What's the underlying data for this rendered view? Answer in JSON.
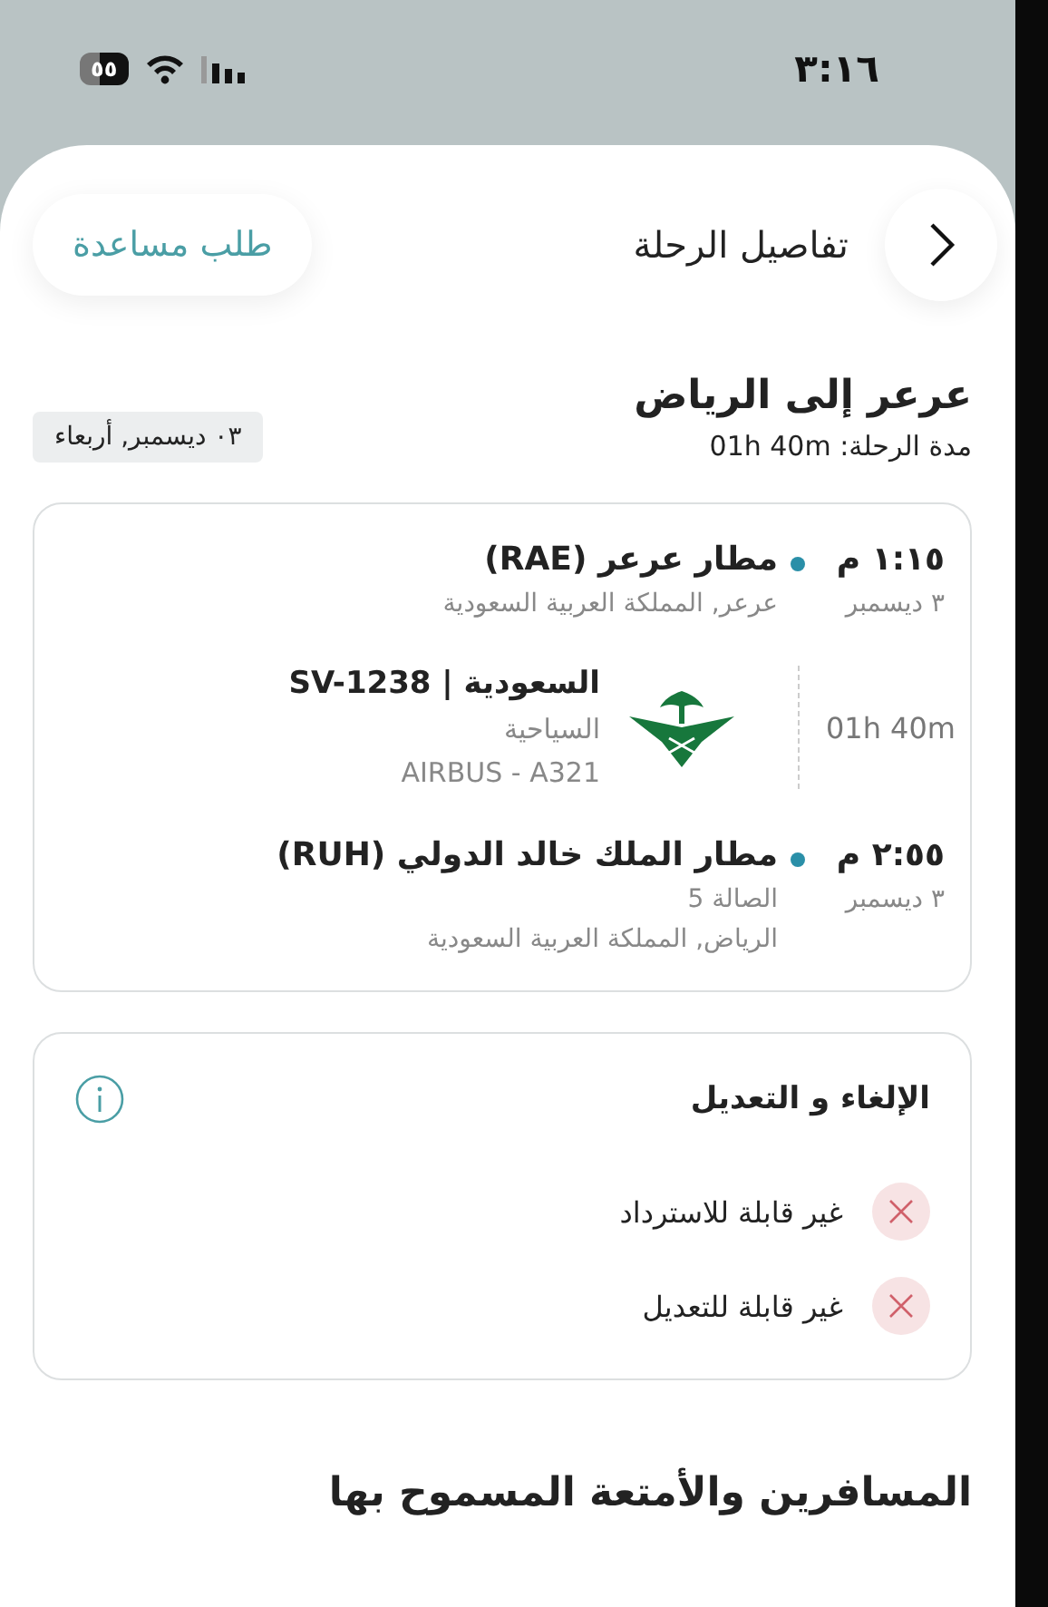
{
  "status_bar": {
    "time": "٣:١٦",
    "battery": "٥٥"
  },
  "header": {
    "title": "تفاصيل الرحلة",
    "help_button": "طلب مساعدة"
  },
  "trip": {
    "route": "عرعر إلى الرياض",
    "duration": "مدة الرحلة: 01h 40m",
    "date": "٠٣ ديسمبر, أربعاء"
  },
  "flight": {
    "departure": {
      "time": "١:١٥ م",
      "date": "٣ ديسمبر",
      "airport": "مطار عرعر (RAE)",
      "lines": [
        "عرعر, المملكة العربية السعودية"
      ]
    },
    "segment": {
      "duration": "01h 40m",
      "airline": "السعودية | SV-1238",
      "cabin": "السياحية",
      "aircraft": "AIRBUS - A321"
    },
    "arrival": {
      "time": "٢:٥٥ م",
      "date": "٣ ديسمبر",
      "airport": "مطار الملك خالد الدولي (RUH)",
      "lines": [
        "الصالة 5",
        "الرياض, المملكة العربية السعودية"
      ]
    }
  },
  "cancellation": {
    "title": "الإلغاء و التعديل",
    "items": [
      {
        "label": "غير قابلة للاسترداد",
        "allowed": false
      },
      {
        "label": "غير قابلة للتعديل",
        "allowed": false
      }
    ]
  },
  "section_heading": "المسافرين والأمتعة المسموح بها"
}
